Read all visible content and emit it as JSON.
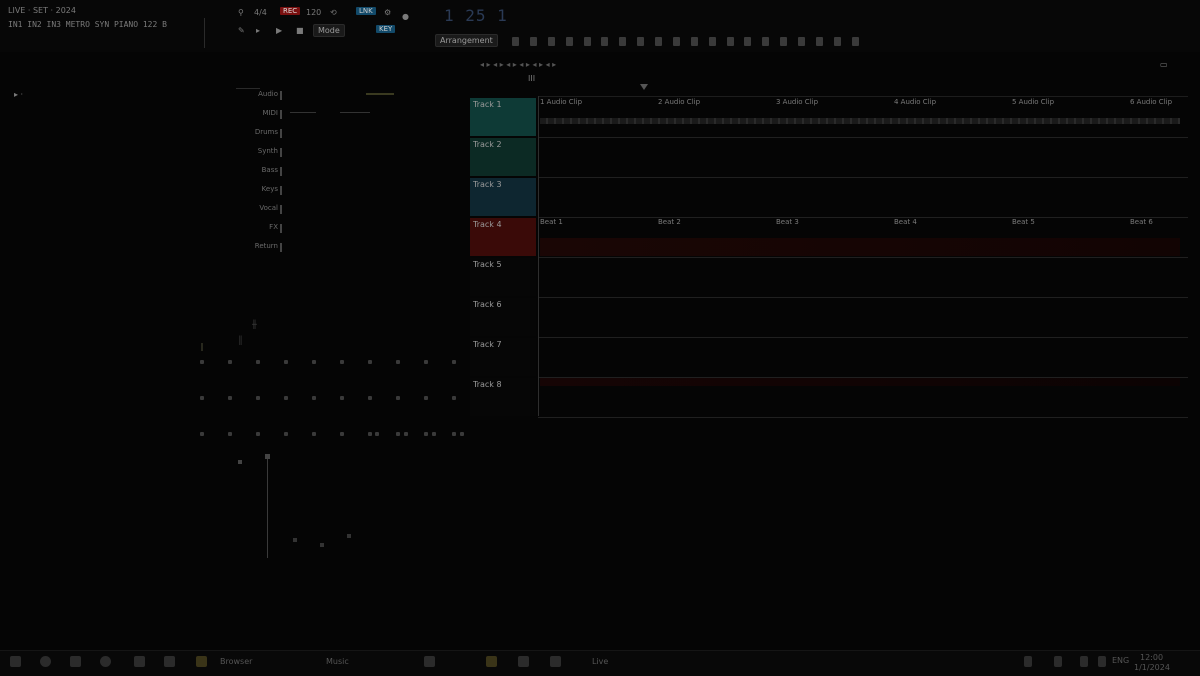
{
  "window": {
    "title_line1": "LIVE · SET · 2024",
    "title_line2": "IN1 IN2 IN3 METRO SYN PIANO 122 B"
  },
  "toolbar": {
    "meter": "4/4",
    "record_badge": "REC",
    "tempo_label": "120",
    "mode_button": "Mode",
    "counter": "1 25 1",
    "view_button": "Arrangement",
    "clip_label": "III"
  },
  "tracks": [
    {
      "name": "Track 1",
      "color": "#0e3a36"
    },
    {
      "name": "Track 2",
      "color": "#0c2a24"
    },
    {
      "name": "Track 3",
      "color": "#0e2630"
    },
    {
      "name": "Track 4",
      "color": "#3a0a08"
    },
    {
      "name": "Track 5",
      "color": "#060606"
    },
    {
      "name": "Track 6",
      "color": "#060606"
    },
    {
      "name": "Track 7",
      "color": "#060606"
    },
    {
      "name": "Track 8",
      "color": "#060606"
    }
  ],
  "ruler_labels": [
    "1 Audio Clip",
    "2 Audio Clip",
    "3 Audio Clip",
    "4 Audio Clip",
    "5 Audio Clip",
    "6 Audio Clip"
  ],
  "region_labels": [
    "Beat 1",
    "Beat 2",
    "Beat 3",
    "Beat 4",
    "Beat 5",
    "Beat 6"
  ],
  "left_panel": {
    "items": [
      "Audio",
      "MIDI",
      "Drums",
      "Synth",
      "Bass",
      "Keys",
      "Vocal",
      "FX",
      "Return"
    ]
  },
  "taskbar": {
    "items": [
      "Start",
      "Search",
      "Task View",
      "Explorer",
      "Browser",
      "Music",
      "Live"
    ],
    "clock_time": "12:00",
    "clock_date": "1/1/2024"
  },
  "colors": {
    "accent_red": "#7a1010",
    "accent_blue": "#124a6a",
    "background": "#050505"
  }
}
